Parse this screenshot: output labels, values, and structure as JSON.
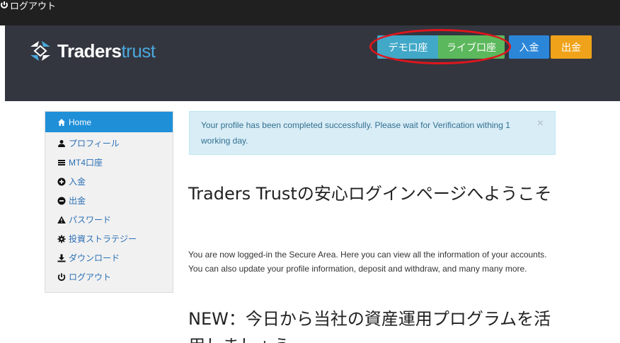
{
  "topbar": {
    "logout_label": "ログアウト"
  },
  "brand": {
    "bold": "Traders",
    "light": "trust"
  },
  "header_buttons": {
    "demo": "デモ口座",
    "live": "ライブ口座",
    "deposit": "入金",
    "withdraw": "出金"
  },
  "sidebar": {
    "items": [
      {
        "label": "Home",
        "icon": "home-icon"
      },
      {
        "label": "プロフィール",
        "icon": "user-icon"
      },
      {
        "label": "MT4口座",
        "icon": "list-icon"
      },
      {
        "label": "入金",
        "icon": "plus-circle-icon"
      },
      {
        "label": "出金",
        "icon": "minus-circle-icon"
      },
      {
        "label": "パスワード",
        "icon": "warning-icon"
      },
      {
        "label": "投資ストラテジー",
        "icon": "cog-icon"
      },
      {
        "label": "ダウンロード",
        "icon": "download-icon"
      },
      {
        "label": "ログアウト",
        "icon": "power-icon"
      }
    ]
  },
  "alert": {
    "message": "Your profile has been completed successfully. Please wait for Verification withing 1 working day.",
    "close": "×"
  },
  "main": {
    "welcome_title": "Traders Trustの安心ログインページへようこそ",
    "intro": "You are now logged-in the Secure Area. Here you can view all the information of your accounts. You can also update your profile information, deposit and withdraw, and many many more.",
    "news_title": "NEW：今日から当社の資産運用プログラムを活用しましょう"
  }
}
